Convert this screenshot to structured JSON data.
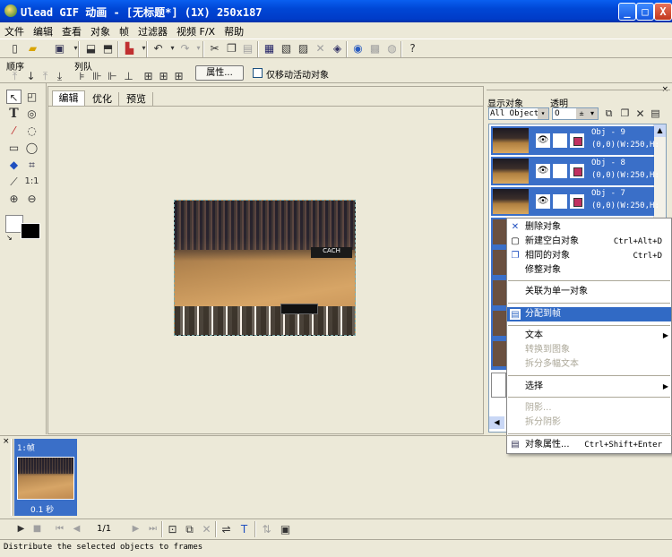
{
  "window": {
    "title": "Ulead GIF 动画 - [无标题*] (1X) 250x187",
    "controls": {
      "minimize": "_",
      "maximize": "□",
      "close": "X"
    }
  },
  "menu": [
    "文件",
    "编辑",
    "查看",
    "对象",
    "帧",
    "过滤器",
    "视频 F/X",
    "帮助"
  ],
  "toolbar2": {
    "order_label": "顺序",
    "queue_label": "列队",
    "properties_button": "属性...",
    "only_move_active_label": "仅移动活动对象"
  },
  "tabs": [
    "编辑",
    "优化",
    "预览"
  ],
  "right_panel": {
    "show_objects_label": "显示对象",
    "transparency_label": "透明",
    "show_objects_value": "All Object",
    "transparency_value": "0"
  },
  "objects": [
    {
      "name": "Obj - 9",
      "info": "(0,0)(W:250,H:"
    },
    {
      "name": "Obj - 8",
      "info": "(0,0)(W:250,H:"
    },
    {
      "name": "Obj - 7",
      "info": "(0,0)(W:250,H:"
    }
  ],
  "context_menu": {
    "items": [
      {
        "label": "删除对象",
        "shortcut": "",
        "icon": "delete-x-icon"
      },
      {
        "label": "新建空白对象",
        "shortcut": "Ctrl+Alt+D",
        "icon": "new-object-icon"
      },
      {
        "label": "相同的对象",
        "shortcut": "Ctrl+D",
        "icon": "duplicate-object-icon"
      },
      {
        "label": "修整对象",
        "shortcut": ""
      },
      {
        "label": "关联为单一对象",
        "shortcut": ""
      },
      {
        "label": "分配到帧",
        "shortcut": "",
        "highlighted": true,
        "icon": "distribute-frames-icon"
      },
      {
        "label": "文本",
        "submenu": true
      },
      {
        "label": "转换到图象",
        "disabled": true
      },
      {
        "label": "拆分多幅文本",
        "disabled": true
      },
      {
        "label": "选择",
        "submenu": true
      },
      {
        "label": "阴影...",
        "disabled": true
      },
      {
        "label": "拆分阴影",
        "disabled": true
      },
      {
        "label": "对象属性...",
        "shortcut": "Ctrl+Shift+Enter",
        "icon": "object-properties-icon"
      }
    ]
  },
  "frames": {
    "frame1_label": "1:帧",
    "frame1_delay": "0.1 秒"
  },
  "playback": {
    "counter": "1/1"
  },
  "status_bar": "Distribute the selected objects to frames",
  "colors": {
    "title_blue": "#0046d5",
    "selection_blue": "#316ac5",
    "obj_row_blue": "#3a6fc8",
    "canvas_bg": "#ece9d8"
  }
}
